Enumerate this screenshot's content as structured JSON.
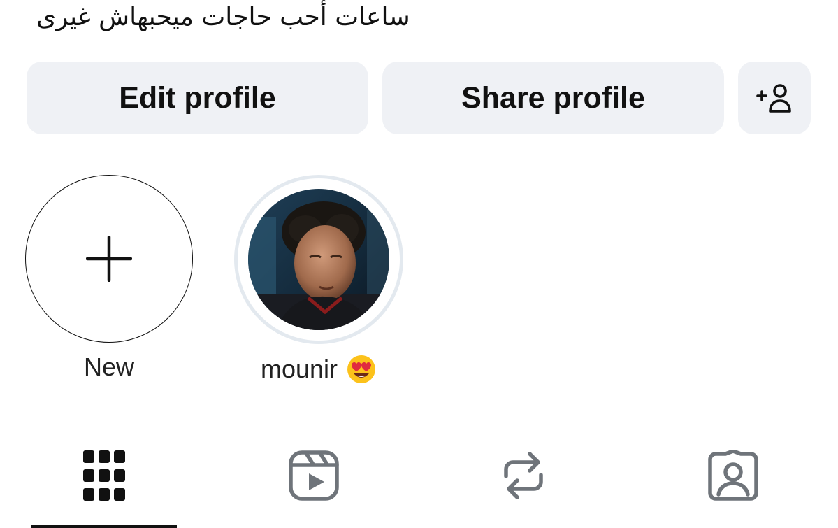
{
  "profile": {
    "bio": "ساعات  أحب حاجات ميحبهاش غيرى"
  },
  "actions": {
    "edit_label": "Edit profile",
    "share_label": "Share profile",
    "add_person_icon": "add-person-icon"
  },
  "highlights": [
    {
      "label": "New",
      "icon": "plus-icon"
    },
    {
      "label": "mounir",
      "emoji": "😍",
      "emoji_icon": "heart-eyes-emoji-icon"
    }
  ],
  "tabs": [
    {
      "name": "grid",
      "icon": "grid-icon",
      "active": true
    },
    {
      "name": "reels",
      "icon": "reels-icon",
      "active": false
    },
    {
      "name": "reposts",
      "icon": "repost-icon",
      "active": false
    },
    {
      "name": "tagged",
      "icon": "tagged-person-icon",
      "active": false
    }
  ],
  "colors": {
    "button_bg": "#eff1f5",
    "text": "#111111",
    "inactive_icon": "#6f747a",
    "story_ring": "#e3e9ef"
  }
}
